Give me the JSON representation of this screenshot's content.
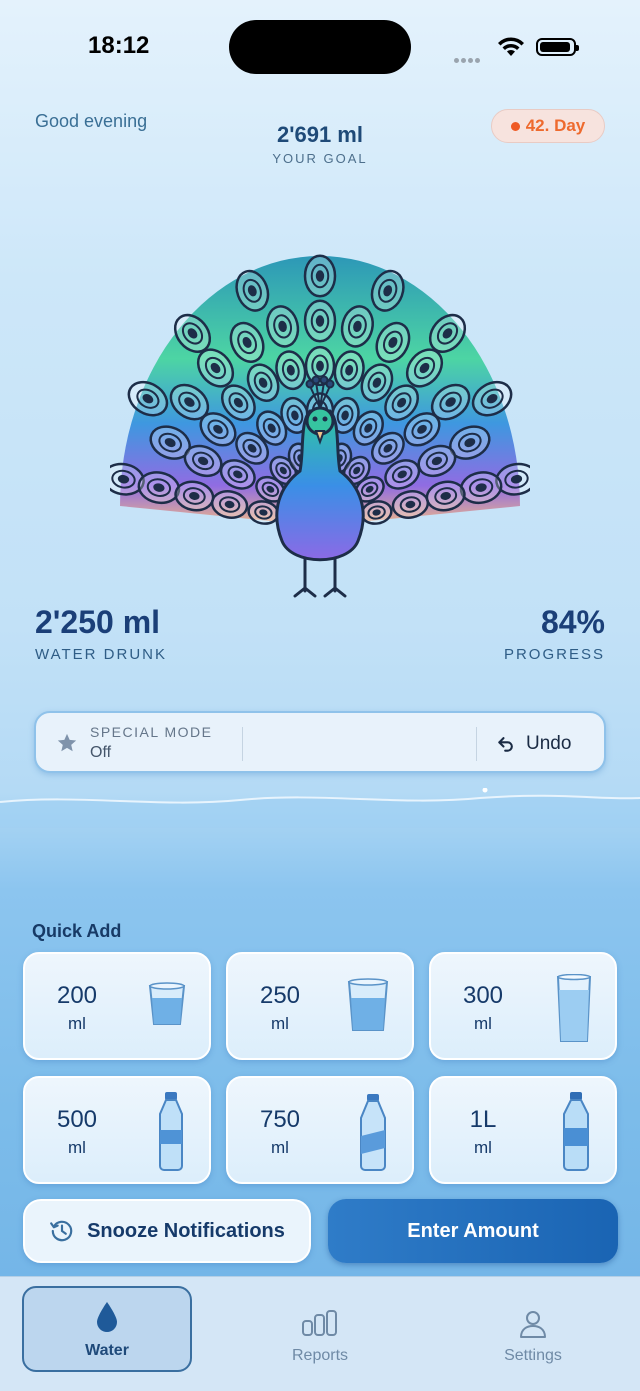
{
  "status_bar": {
    "time": "18:12"
  },
  "header": {
    "greeting": "Good evening",
    "goal_value": "2'691 ml",
    "goal_label": "YOUR GOAL",
    "day_badge": "42. Day"
  },
  "stats": {
    "drunk_value": "2'250 ml",
    "drunk_label": "WATER DRUNK",
    "progress_value": "84%",
    "progress_label": "PROGRESS"
  },
  "special_mode": {
    "title": "SPECIAL MODE",
    "value": "Off",
    "undo_label": "Undo"
  },
  "quick_add": {
    "title": "Quick Add",
    "items": [
      {
        "amount": "200",
        "unit": "ml",
        "icon": "small-glass-icon"
      },
      {
        "amount": "250",
        "unit": "ml",
        "icon": "glass-icon"
      },
      {
        "amount": "300",
        "unit": "ml",
        "icon": "tall-glass-icon"
      },
      {
        "amount": "500",
        "unit": "ml",
        "icon": "bottle-icon"
      },
      {
        "amount": "750",
        "unit": "ml",
        "icon": "bottle-icon"
      },
      {
        "amount": "1L",
        "unit": "ml",
        "icon": "large-bottle-icon"
      }
    ]
  },
  "actions": {
    "snooze_label": "Snooze Notifications",
    "enter_label": "Enter Amount"
  },
  "tabs": [
    {
      "label": "Water",
      "icon": "water-drop-icon",
      "active": true
    },
    {
      "label": "Reports",
      "icon": "bar-chart-icon",
      "active": false
    },
    {
      "label": "Settings",
      "icon": "person-icon",
      "active": false
    }
  ],
  "colors": {
    "accent": "#1a64b3",
    "text_dark": "#163a6a",
    "badge_text": "#ee6a2e"
  }
}
